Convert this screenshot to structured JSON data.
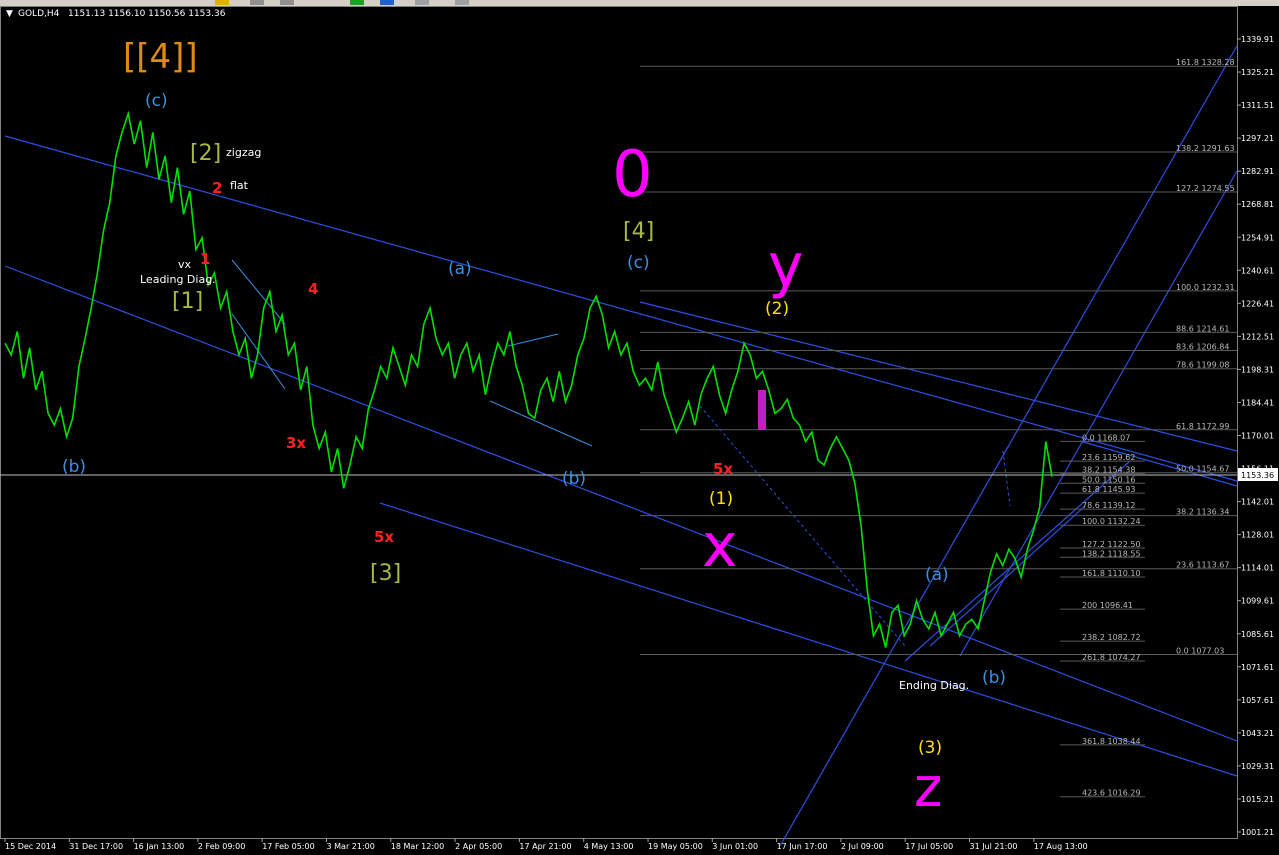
{
  "toolbar": {
    "buttons": [
      "pointer-icon",
      "crosshair-icon",
      "zoom-icon",
      "add-icon",
      "refresh-icon",
      "template-icon",
      "period-icon"
    ]
  },
  "header": {
    "symbol": "GOLD,H4",
    "ohlc": "1151.13 1156.10 1150.56 1153.36"
  },
  "current_price": "1153.36",
  "chart_data": {
    "type": "line",
    "symbol": "GOLD,H4",
    "ylim": [
      1001.21,
      1339.91
    ],
    "y_ticks": [
      "1339.91",
      "1325.21",
      "1311.51",
      "1297.21",
      "1282.91",
      "1268.81",
      "1254.91",
      "1240.61",
      "1226.41",
      "1212.51",
      "1198.31",
      "1184.41",
      "1170.01",
      "1156.11",
      "1142.01",
      "1128.01",
      "1114.01",
      "1099.61",
      "1085.61",
      "1071.61",
      "1057.61",
      "1043.21",
      "1029.31",
      "1015.21",
      "1001.21"
    ],
    "x_ticks": [
      "15 Dec 2014",
      "31 Dec 17:00",
      "16 Jan 13:00",
      "2 Feb 09:00",
      "17 Feb 05:00",
      "3 Mar 21:00",
      "18 Mar 12:00",
      "2 Apr 05:00",
      "17 Apr 21:00",
      "4 May 13:00",
      "19 May 05:00",
      "3 Jun 01:00",
      "17 Jun 17:00",
      "2 Jul 09:00",
      "17 Jul 05:00",
      "31 Jul 21:00",
      "17 Aug 13:00"
    ],
    "series": [
      {
        "color": "#00e000",
        "points": [
          [
            0,
            1210
          ],
          [
            2,
            1205
          ],
          [
            4,
            1215
          ],
          [
            6,
            1195
          ],
          [
            8,
            1208
          ],
          [
            10,
            1190
          ],
          [
            12,
            1198
          ],
          [
            14,
            1180
          ],
          [
            16,
            1175
          ],
          [
            18,
            1182
          ],
          [
            20,
            1170
          ],
          [
            22,
            1178
          ],
          [
            24,
            1200
          ],
          [
            26,
            1212
          ],
          [
            28,
            1225
          ],
          [
            30,
            1240
          ],
          [
            32,
            1258
          ],
          [
            34,
            1270
          ],
          [
            36,
            1290
          ],
          [
            38,
            1300
          ],
          [
            40,
            1308
          ],
          [
            42,
            1295
          ],
          [
            44,
            1305
          ],
          [
            46,
            1285
          ],
          [
            48,
            1300
          ],
          [
            50,
            1280
          ],
          [
            52,
            1290
          ],
          [
            54,
            1270
          ],
          [
            56,
            1285
          ],
          [
            58,
            1265
          ],
          [
            60,
            1275
          ],
          [
            62,
            1250
          ],
          [
            64,
            1255
          ],
          [
            66,
            1235
          ],
          [
            68,
            1240
          ],
          [
            70,
            1225
          ],
          [
            72,
            1232
          ],
          [
            74,
            1215
          ],
          [
            76,
            1205
          ],
          [
            78,
            1212
          ],
          [
            80,
            1195
          ],
          [
            82,
            1205
          ],
          [
            84,
            1225
          ],
          [
            86,
            1232
          ],
          [
            88,
            1215
          ],
          [
            90,
            1222
          ],
          [
            92,
            1205
          ],
          [
            94,
            1210
          ],
          [
            96,
            1190
          ],
          [
            98,
            1200
          ],
          [
            100,
            1175
          ],
          [
            102,
            1165
          ],
          [
            104,
            1172
          ],
          [
            106,
            1155
          ],
          [
            108,
            1165
          ],
          [
            110,
            1148
          ],
          [
            112,
            1158
          ],
          [
            114,
            1170
          ],
          [
            116,
            1165
          ],
          [
            118,
            1182
          ],
          [
            120,
            1190
          ],
          [
            122,
            1200
          ],
          [
            124,
            1195
          ],
          [
            126,
            1208
          ],
          [
            128,
            1200
          ],
          [
            130,
            1192
          ],
          [
            132,
            1205
          ],
          [
            134,
            1200
          ],
          [
            136,
            1218
          ],
          [
            138,
            1225
          ],
          [
            140,
            1212
          ],
          [
            142,
            1205
          ],
          [
            144,
            1210
          ],
          [
            146,
            1195
          ],
          [
            148,
            1205
          ],
          [
            150,
            1210
          ],
          [
            152,
            1198
          ],
          [
            154,
            1205
          ],
          [
            156,
            1188
          ],
          [
            158,
            1200
          ],
          [
            160,
            1210
          ],
          [
            162,
            1205
          ],
          [
            164,
            1215
          ],
          [
            166,
            1200
          ],
          [
            168,
            1192
          ],
          [
            170,
            1180
          ],
          [
            172,
            1178
          ],
          [
            174,
            1190
          ],
          [
            176,
            1195
          ],
          [
            178,
            1185
          ],
          [
            180,
            1198
          ],
          [
            182,
            1185
          ],
          [
            184,
            1192
          ],
          [
            186,
            1205
          ],
          [
            188,
            1212
          ],
          [
            190,
            1225
          ],
          [
            192,
            1230
          ],
          [
            194,
            1222
          ],
          [
            196,
            1208
          ],
          [
            198,
            1215
          ],
          [
            200,
            1205
          ],
          [
            202,
            1210
          ],
          [
            204,
            1198
          ],
          [
            206,
            1192
          ],
          [
            208,
            1195
          ],
          [
            210,
            1190
          ],
          [
            212,
            1202
          ],
          [
            214,
            1188
          ],
          [
            216,
            1180
          ],
          [
            218,
            1172
          ],
          [
            220,
            1178
          ],
          [
            222,
            1185
          ],
          [
            224,
            1175
          ],
          [
            226,
            1188
          ],
          [
            228,
            1195
          ],
          [
            230,
            1200
          ],
          [
            232,
            1188
          ],
          [
            234,
            1180
          ],
          [
            236,
            1190
          ],
          [
            238,
            1198
          ],
          [
            240,
            1210
          ],
          [
            242,
            1205
          ],
          [
            244,
            1195
          ],
          [
            246,
            1198
          ],
          [
            248,
            1190
          ],
          [
            250,
            1180
          ],
          [
            252,
            1182
          ],
          [
            254,
            1186
          ],
          [
            256,
            1178
          ],
          [
            258,
            1175
          ],
          [
            260,
            1168
          ],
          [
            262,
            1172
          ],
          [
            264,
            1160
          ],
          [
            266,
            1158
          ],
          [
            268,
            1165
          ],
          [
            270,
            1170
          ],
          [
            272,
            1165
          ],
          [
            274,
            1160
          ],
          [
            276,
            1150
          ],
          [
            278,
            1132
          ],
          [
            280,
            1105
          ],
          [
            282,
            1085
          ],
          [
            284,
            1090
          ],
          [
            286,
            1080
          ],
          [
            288,
            1095
          ],
          [
            290,
            1098
          ],
          [
            292,
            1085
          ],
          [
            294,
            1090
          ],
          [
            296,
            1100
          ],
          [
            298,
            1092
          ],
          [
            300,
            1088
          ],
          [
            302,
            1095
          ],
          [
            304,
            1085
          ],
          [
            306,
            1090
          ],
          [
            308,
            1095
          ],
          [
            310,
            1085
          ],
          [
            312,
            1090
          ],
          [
            314,
            1092
          ],
          [
            316,
            1088
          ],
          [
            318,
            1100
          ],
          [
            320,
            1112
          ],
          [
            322,
            1120
          ],
          [
            324,
            1115
          ],
          [
            326,
            1122
          ],
          [
            328,
            1118
          ],
          [
            330,
            1110
          ],
          [
            332,
            1122
          ],
          [
            334,
            1130
          ],
          [
            336,
            1140
          ],
          [
            338,
            1168
          ],
          [
            340,
            1153
          ]
        ]
      }
    ],
    "annotations": [
      {
        "text": "[[4]]",
        "color": "#e08a10"
      },
      {
        "text": "(c)",
        "color": "#3b8fe0"
      },
      {
        "text": "[2]",
        "color": "#a8b840"
      },
      {
        "text": "zigzag",
        "color": "#ffffff"
      },
      {
        "text": "flat",
        "color": "#ffffff"
      },
      {
        "text": "2",
        "color": "#ff2020"
      },
      {
        "text": "1",
        "color": "#ff2020"
      },
      {
        "text": "vx",
        "color": "#ffffff"
      },
      {
        "text": "Leading Diag.",
        "color": "#ffffff"
      },
      {
        "text": "[1]",
        "color": "#a8b840"
      },
      {
        "text": "4",
        "color": "#ff2020"
      },
      {
        "text": "3x",
        "color": "#ff2020"
      },
      {
        "text": "(b)",
        "color": "#3b8fe0"
      },
      {
        "text": "5x",
        "color": "#ff2020"
      },
      {
        "text": "[3]",
        "color": "#a8b840"
      },
      {
        "text": "(a)",
        "color": "#3b8fe0"
      },
      {
        "text": "(b)",
        "color": "#3b8fe0"
      },
      {
        "text": "0",
        "color": "#ff00ff"
      },
      {
        "text": "[4]",
        "color": "#a8b840"
      },
      {
        "text": "(c)",
        "color": "#3b8fe0"
      },
      {
        "text": "y",
        "color": "#ff00ff"
      },
      {
        "text": "(2)",
        "color": "#ffe000"
      },
      {
        "text": "x",
        "color": "#ff00ff"
      },
      {
        "text": "(1)",
        "color": "#ffe000"
      },
      {
        "text": "5x",
        "color": "#ff2020"
      },
      {
        "text": "z",
        "color": "#ff00ff"
      },
      {
        "text": "(3)",
        "color": "#ffe000"
      },
      {
        "text": "Ending Diag.",
        "color": "#ffffff"
      },
      {
        "text": "(a)",
        "color": "#3b8fe0"
      },
      {
        "text": "(b)",
        "color": "#3b8fe0"
      }
    ],
    "fib_levels_right": [
      {
        "label": "161.8 1328.28"
      },
      {
        "label": "138.2 1291.63"
      },
      {
        "label": "127.2 1274.55"
      },
      {
        "label": "100.0 1232.31"
      },
      {
        "label": "88.6 1214.61"
      },
      {
        "label": "83.6 1206.84"
      },
      {
        "label": "78.6 1199.08"
      },
      {
        "label": "61.8 1172.99"
      },
      {
        "label": "50.0 1154.67"
      },
      {
        "label": "38.2 1136.34"
      },
      {
        "label": "23.6 1113.67"
      },
      {
        "label": "0.0 1077.03"
      }
    ],
    "fib_levels_mid": [
      {
        "label": "0.0 1168.07"
      },
      {
        "label": "23.6 1159.62"
      },
      {
        "label": "38.2 1154.38"
      },
      {
        "label": "50.0 1150.16"
      },
      {
        "label": "61.8 1145.93"
      },
      {
        "label": "78.6 1139.12"
      },
      {
        "label": "100.0 1132.24"
      },
      {
        "label": "127.2 1122.50"
      },
      {
        "label": "138.2 1118.55"
      },
      {
        "label": "161.8 1110.10"
      },
      {
        "label": "200 1096.41"
      },
      {
        "label": "238.2 1082.72"
      },
      {
        "label": "261.8 1074.27"
      },
      {
        "label": "361.8 1038.44"
      },
      {
        "label": "423.6 1016.29"
      }
    ],
    "grid": false
  }
}
